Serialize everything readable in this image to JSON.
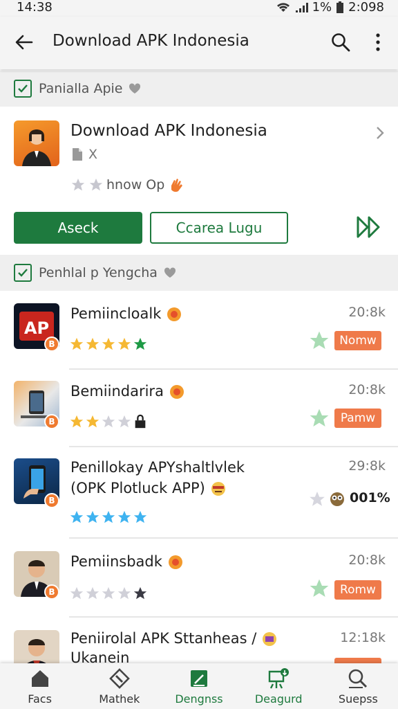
{
  "status_bar": {
    "time": "14:38",
    "battery": "1%",
    "clock_right": "2:098"
  },
  "app_bar": {
    "title": "Download APK Indonesia",
    "back_icon": "arrow-left-icon",
    "search_icon": "search-icon",
    "more_icon": "more-vert-icon"
  },
  "section1": {
    "label": "Panialla Apie"
  },
  "featured": {
    "name": "Download APK Indonesia",
    "meta": "X",
    "sub": "hnow Op",
    "primary_label": "Aseck",
    "secondary_label": "Ccarea Lugu"
  },
  "section2": {
    "label": "Penhlal p Yengcha"
  },
  "items": [
    {
      "name": "Pemiincloalk",
      "size": "20:8k",
      "pill": "Nomw",
      "rating": 5
    },
    {
      "name": "Bemiindarira",
      "size": "20:8k",
      "pill": "Pamw",
      "rating": 2
    },
    {
      "name": "Penillokay APYshaltlvlek",
      "name2": "(OPK Plotluck APP)",
      "size": "29:8k",
      "right_text": "001%",
      "rating": 5
    },
    {
      "name": "Pemiinsbadk",
      "size": "20:8k",
      "pill": "Romw",
      "rating": 0
    },
    {
      "name": "Peniirolal APK Sttanheas /",
      "name2": "Ukanein",
      "size": "12:18k"
    }
  ],
  "bottom_nav": [
    {
      "label": "Facs",
      "icon": "home-icon"
    },
    {
      "label": "Mathek",
      "icon": "tag-icon"
    },
    {
      "label": "Dengnss",
      "icon": "edit-square-icon"
    },
    {
      "label": "Deagurd",
      "icon": "download-board-icon"
    },
    {
      "label": "Suepss",
      "icon": "search-icon"
    }
  ],
  "colors": {
    "accent_green": "#1e7a3e",
    "pill_orange": "#ef7a4a",
    "star_gold": "#f5b833"
  }
}
